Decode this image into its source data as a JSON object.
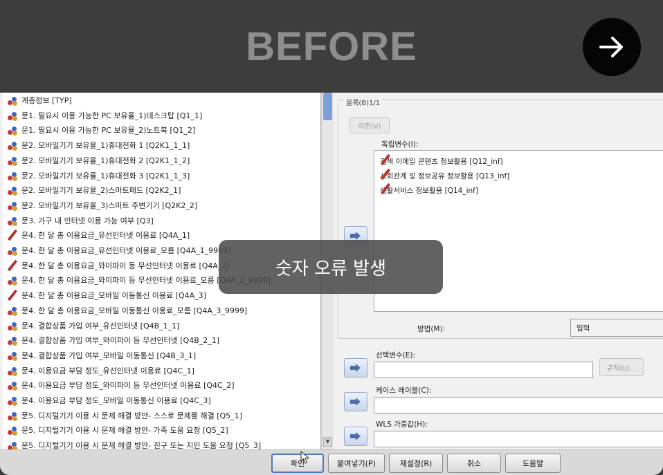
{
  "header": {
    "title": "BEFORE",
    "next_icon": "arrow-right-icon"
  },
  "toast": {
    "message": "숫자 오류 발생"
  },
  "variable_list": [
    {
      "label": "계층정보 [TYP]",
      "icon": "nominal-icon"
    },
    {
      "label": "문1. 필요시 이용 가능한 PC 보유율_1)데스크탑 [Q1_1]",
      "icon": "nominal-icon"
    },
    {
      "label": "문1. 필요시 이용 가능한 PC 보유율_2)노트북 [Q1_2]",
      "icon": "nominal-icon"
    },
    {
      "label": "문2. 모바일기기 보유율_1)휴대전화 1 [Q2K1_1_1]",
      "icon": "nominal-icon"
    },
    {
      "label": "문2. 모바일기기 보유율_1)휴대전화 2 [Q2K1_1_2]",
      "icon": "nominal-icon"
    },
    {
      "label": "문2. 모바일기기 보유율_1)휴대전화 3 [Q2K1_1_3]",
      "icon": "nominal-icon"
    },
    {
      "label": "문2. 모바일기기 보유율_2)스마트패드 [Q2K2_1]",
      "icon": "nominal-icon"
    },
    {
      "label": "문2. 모바일기기 보유율_3)스마트 주변기기 [Q2K2_2]",
      "icon": "nominal-icon"
    },
    {
      "label": "문3. 가구 내 인터넷 이용 가능 여부 [Q3]",
      "icon": "nominal-icon"
    },
    {
      "label": "문4. 한 달 총 이용요금_유선인터넷 이용료 [Q4A_1]",
      "icon": "scale-icon"
    },
    {
      "label": "문4. 한 달 총 이용요금_유선인터넷 이용료_모름 [Q4A_1_9999]",
      "icon": "nominal-icon"
    },
    {
      "label": "문4. 한 달 총 이용요금_와이파이 등 무선인터넷 이용료 [Q4A_2]",
      "icon": "scale-icon"
    },
    {
      "label": "문4. 한 달 총 이용요금_와이파이 등 무선인터넷 이용료_모름 [Q4A_2_9999]",
      "icon": "nominal-icon"
    },
    {
      "label": "문4. 한 달 총 이용요금_모바일 이동통신 이용료 [Q4A_3]",
      "icon": "scale-icon"
    },
    {
      "label": "문4. 한 달 총 이용요금_모바일 이동통신 이용료_모름 [Q4A_3_9999]",
      "icon": "nominal-icon"
    },
    {
      "label": "문4. 결합상품 가입 여부_유선인터넷 [Q4B_1_1]",
      "icon": "nominal-icon"
    },
    {
      "label": "문4. 결합상품 가입 여부_와이파이 등 무선인터넷 [Q4B_2_1]",
      "icon": "nominal-icon"
    },
    {
      "label": "문4. 결합상품 가입 여부_모바일 이동통신 [Q4B_3_1]",
      "icon": "nominal-icon"
    },
    {
      "label": "문4. 이용요금 부담 정도_유선인터넷 이용료 [Q4C_1]",
      "icon": "nominal-icon"
    },
    {
      "label": "문4. 이용요금 부담 정도_와이파이 등 무선인터넷 이용료 [Q4C_2]",
      "icon": "nominal-icon"
    },
    {
      "label": "문4. 이용요금 부담 정도_모바일 이동통신 이용료 [Q4C_3]",
      "icon": "nominal-icon"
    },
    {
      "label": "문5. 디지털기기 이용 시 문제 해결 방안- 스스로 문제를 해결 [Q5_1]",
      "icon": "nominal-icon"
    },
    {
      "label": "문5. 디지털기기 이용 시 문제 해결 방안- 가족 도움 요청 [Q5_2]",
      "icon": "nominal-icon"
    },
    {
      "label": "문5. 디지털기기 이용 시 문제 해결 방안- 친구 또는 지인 도움 요청 [Q5_3]",
      "icon": "nominal-icon"
    }
  ],
  "right_panel": {
    "block_label": "블록(B)1/1",
    "prev_button": "이전(V)",
    "independent_label": "독립변수(I):",
    "independent_vars": [
      {
        "label": "검색 이메일 콘텐츠 정보활용 [Q12_inf]",
        "icon": "scale-icon"
      },
      {
        "label": "사회관계 및 정보공유 정보활용 [Q13_inf]",
        "icon": "scale-icon"
      },
      {
        "label": "생활서비스 정보활용 [Q14_inf]",
        "icon": "scale-icon"
      }
    ],
    "method_label": "방법(M):",
    "method_value": "입력",
    "selection_label": "선택변수(E):",
    "rule_button": "규칙(U)...",
    "case_label": "케이스 레이블(C):",
    "wls_label": "WLS 가중값(H):"
  },
  "buttons": {
    "ok": "확인",
    "paste": "붙여넣기(P)",
    "reset": "재설정(R)",
    "cancel": "취소",
    "help": "도움말"
  }
}
